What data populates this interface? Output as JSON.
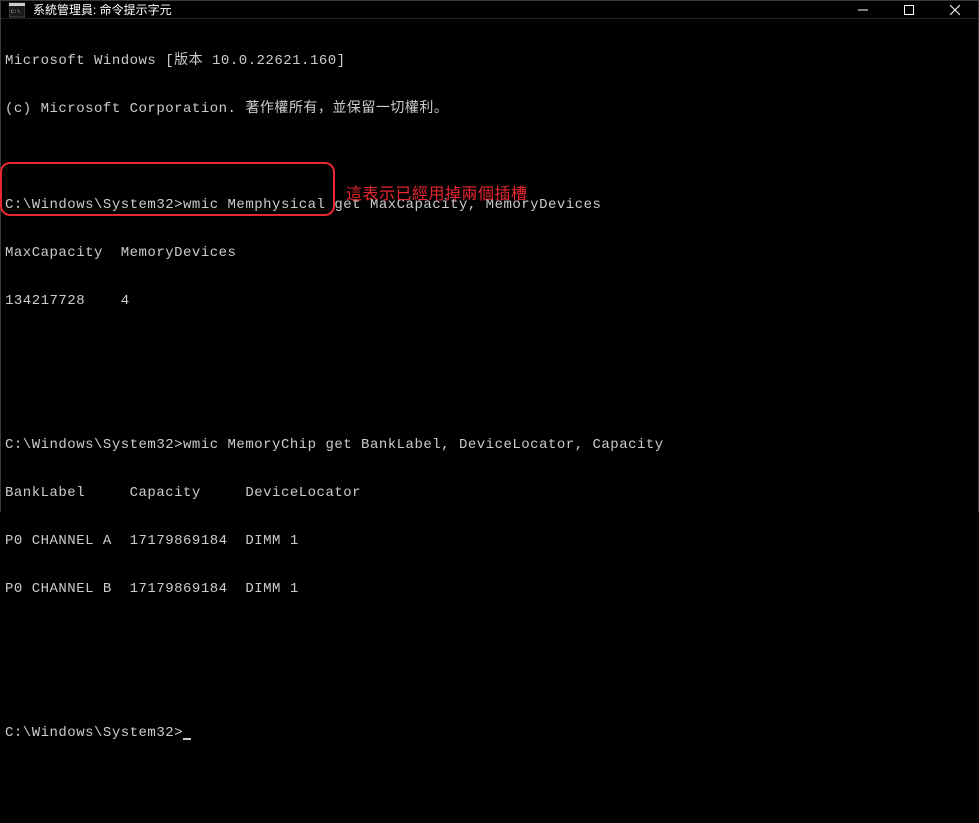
{
  "titlebar": {
    "title": "系統管理員: 命令提示字元"
  },
  "terminal": {
    "line1": "Microsoft Windows [版本 10.0.22621.160]",
    "line2": "(c) Microsoft Corporation. 著作權所有，並保留一切權利。",
    "line3": "",
    "line4": "C:\\Windows\\System32>wmic Memphysical get MaxCapacity, MemoryDevices",
    "line5": "MaxCapacity  MemoryDevices",
    "line6": "134217728    4",
    "line7": "",
    "line8": "",
    "line9": "C:\\Windows\\System32>wmic MemoryChip get BankLabel, DeviceLocator, Capacity",
    "line10": "BankLabel     Capacity     DeviceLocator",
    "line11": "P0 CHANNEL A  17179869184  DIMM 1",
    "line12": "P0 CHANNEL B  17179869184  DIMM 1",
    "line13": "",
    "line14": "",
    "line15": "C:\\Windows\\System32>"
  },
  "annotation": {
    "text": "這表示已經用掉兩個插槽"
  },
  "chart_data": {
    "type": "table",
    "tables": [
      {
        "command": "wmic Memphysical get MaxCapacity, MemoryDevices",
        "headers": [
          "MaxCapacity",
          "MemoryDevices"
        ],
        "rows": [
          [
            "134217728",
            "4"
          ]
        ]
      },
      {
        "command": "wmic MemoryChip get BankLabel, DeviceLocator, Capacity",
        "headers": [
          "BankLabel",
          "Capacity",
          "DeviceLocator"
        ],
        "rows": [
          [
            "P0 CHANNEL A",
            "17179869184",
            "DIMM 1"
          ],
          [
            "P0 CHANNEL B",
            "17179869184",
            "DIMM 1"
          ]
        ]
      }
    ]
  }
}
